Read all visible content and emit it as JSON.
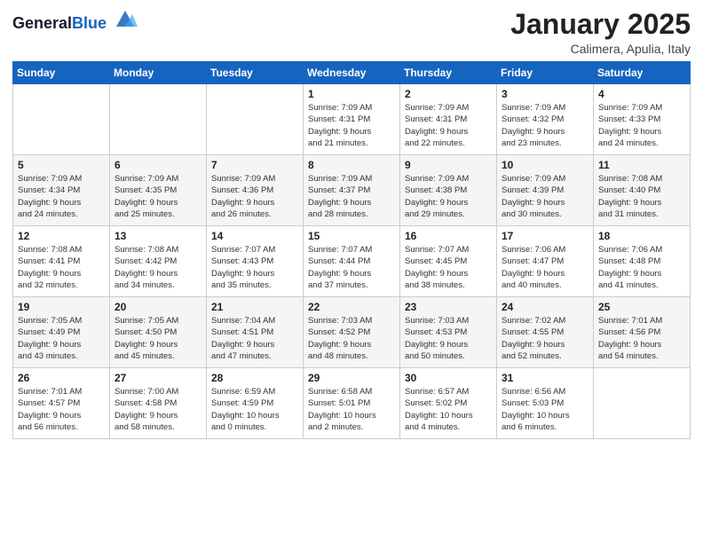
{
  "logo": {
    "general": "General",
    "blue": "Blue"
  },
  "header": {
    "month": "January 2025",
    "location": "Calimera, Apulia, Italy"
  },
  "weekdays": [
    "Sunday",
    "Monday",
    "Tuesday",
    "Wednesday",
    "Thursday",
    "Friday",
    "Saturday"
  ],
  "weeks": [
    [
      {
        "day": "",
        "info": ""
      },
      {
        "day": "",
        "info": ""
      },
      {
        "day": "",
        "info": ""
      },
      {
        "day": "1",
        "info": "Sunrise: 7:09 AM\nSunset: 4:31 PM\nDaylight: 9 hours\nand 21 minutes."
      },
      {
        "day": "2",
        "info": "Sunrise: 7:09 AM\nSunset: 4:31 PM\nDaylight: 9 hours\nand 22 minutes."
      },
      {
        "day": "3",
        "info": "Sunrise: 7:09 AM\nSunset: 4:32 PM\nDaylight: 9 hours\nand 23 minutes."
      },
      {
        "day": "4",
        "info": "Sunrise: 7:09 AM\nSunset: 4:33 PM\nDaylight: 9 hours\nand 24 minutes."
      }
    ],
    [
      {
        "day": "5",
        "info": "Sunrise: 7:09 AM\nSunset: 4:34 PM\nDaylight: 9 hours\nand 24 minutes."
      },
      {
        "day": "6",
        "info": "Sunrise: 7:09 AM\nSunset: 4:35 PM\nDaylight: 9 hours\nand 25 minutes."
      },
      {
        "day": "7",
        "info": "Sunrise: 7:09 AM\nSunset: 4:36 PM\nDaylight: 9 hours\nand 26 minutes."
      },
      {
        "day": "8",
        "info": "Sunrise: 7:09 AM\nSunset: 4:37 PM\nDaylight: 9 hours\nand 28 minutes."
      },
      {
        "day": "9",
        "info": "Sunrise: 7:09 AM\nSunset: 4:38 PM\nDaylight: 9 hours\nand 29 minutes."
      },
      {
        "day": "10",
        "info": "Sunrise: 7:09 AM\nSunset: 4:39 PM\nDaylight: 9 hours\nand 30 minutes."
      },
      {
        "day": "11",
        "info": "Sunrise: 7:08 AM\nSunset: 4:40 PM\nDaylight: 9 hours\nand 31 minutes."
      }
    ],
    [
      {
        "day": "12",
        "info": "Sunrise: 7:08 AM\nSunset: 4:41 PM\nDaylight: 9 hours\nand 32 minutes."
      },
      {
        "day": "13",
        "info": "Sunrise: 7:08 AM\nSunset: 4:42 PM\nDaylight: 9 hours\nand 34 minutes."
      },
      {
        "day": "14",
        "info": "Sunrise: 7:07 AM\nSunset: 4:43 PM\nDaylight: 9 hours\nand 35 minutes."
      },
      {
        "day": "15",
        "info": "Sunrise: 7:07 AM\nSunset: 4:44 PM\nDaylight: 9 hours\nand 37 minutes."
      },
      {
        "day": "16",
        "info": "Sunrise: 7:07 AM\nSunset: 4:45 PM\nDaylight: 9 hours\nand 38 minutes."
      },
      {
        "day": "17",
        "info": "Sunrise: 7:06 AM\nSunset: 4:47 PM\nDaylight: 9 hours\nand 40 minutes."
      },
      {
        "day": "18",
        "info": "Sunrise: 7:06 AM\nSunset: 4:48 PM\nDaylight: 9 hours\nand 41 minutes."
      }
    ],
    [
      {
        "day": "19",
        "info": "Sunrise: 7:05 AM\nSunset: 4:49 PM\nDaylight: 9 hours\nand 43 minutes."
      },
      {
        "day": "20",
        "info": "Sunrise: 7:05 AM\nSunset: 4:50 PM\nDaylight: 9 hours\nand 45 minutes."
      },
      {
        "day": "21",
        "info": "Sunrise: 7:04 AM\nSunset: 4:51 PM\nDaylight: 9 hours\nand 47 minutes."
      },
      {
        "day": "22",
        "info": "Sunrise: 7:03 AM\nSunset: 4:52 PM\nDaylight: 9 hours\nand 48 minutes."
      },
      {
        "day": "23",
        "info": "Sunrise: 7:03 AM\nSunset: 4:53 PM\nDaylight: 9 hours\nand 50 minutes."
      },
      {
        "day": "24",
        "info": "Sunrise: 7:02 AM\nSunset: 4:55 PM\nDaylight: 9 hours\nand 52 minutes."
      },
      {
        "day": "25",
        "info": "Sunrise: 7:01 AM\nSunset: 4:56 PM\nDaylight: 9 hours\nand 54 minutes."
      }
    ],
    [
      {
        "day": "26",
        "info": "Sunrise: 7:01 AM\nSunset: 4:57 PM\nDaylight: 9 hours\nand 56 minutes."
      },
      {
        "day": "27",
        "info": "Sunrise: 7:00 AM\nSunset: 4:58 PM\nDaylight: 9 hours\nand 58 minutes."
      },
      {
        "day": "28",
        "info": "Sunrise: 6:59 AM\nSunset: 4:59 PM\nDaylight: 10 hours\nand 0 minutes."
      },
      {
        "day": "29",
        "info": "Sunrise: 6:58 AM\nSunset: 5:01 PM\nDaylight: 10 hours\nand 2 minutes."
      },
      {
        "day": "30",
        "info": "Sunrise: 6:57 AM\nSunset: 5:02 PM\nDaylight: 10 hours\nand 4 minutes."
      },
      {
        "day": "31",
        "info": "Sunrise: 6:56 AM\nSunset: 5:03 PM\nDaylight: 10 hours\nand 6 minutes."
      },
      {
        "day": "",
        "info": ""
      }
    ]
  ]
}
